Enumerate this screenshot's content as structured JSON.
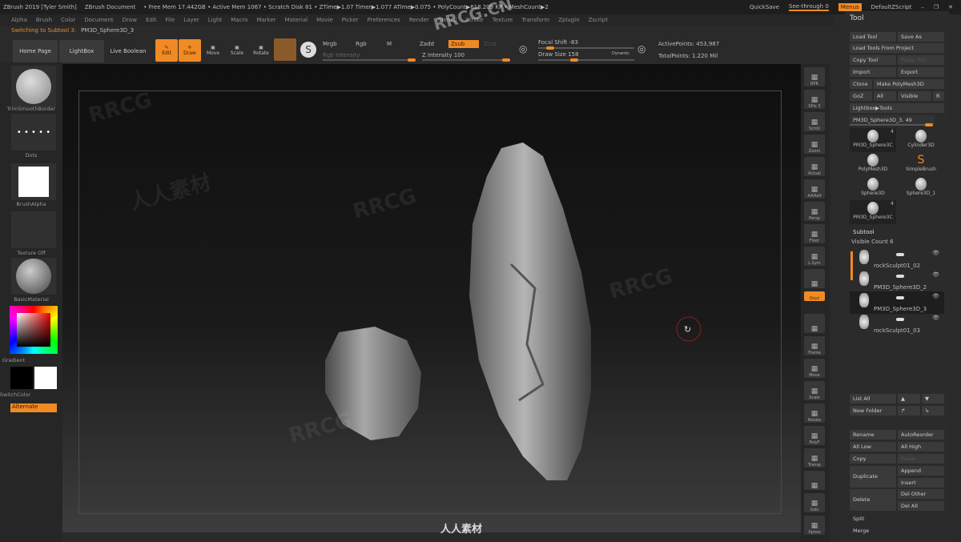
{
  "titlebar": {
    "app": "ZBrush 2019 [Tyler Smith]",
    "doc": "ZBrush Document",
    "stats": "• Free Mem 17.442GB • Active Mem 1067 • Scratch Disk 81 • ZTime▶1.07 Timer▶1.077 ATime▶0.075 • PolyCount▶618.209 KP • MeshCount▶2",
    "quicksave": "QuickSave",
    "see_through": "See-through  0",
    "menus": "Menus",
    "script": "DefaultZScript"
  },
  "menubar": [
    "Alpha",
    "Brush",
    "Color",
    "Document",
    "Draw",
    "Edit",
    "File",
    "Layer",
    "Light",
    "Macro",
    "Marker",
    "Material",
    "Movie",
    "Picker",
    "Preferences",
    "Render",
    "Stencil",
    "Stroke",
    "Texture",
    "Transform",
    "Zplugin",
    "Zscript"
  ],
  "subtitle": {
    "status": "Switching to Subtool 3:",
    "name": "PM3D_Sphere3D_3"
  },
  "toolbar": {
    "home": "Home Page",
    "lightbox": "LightBox",
    "live_boolean": "Live Boolean",
    "edit": "Edit",
    "draw": "Draw",
    "move": "Move",
    "scale": "Scale",
    "rotate": "Rotate",
    "mrgb": "Mrgb",
    "rgb": "Rgb",
    "m": "M",
    "rgb_intensity": "Rgb Intensity",
    "zadd": "Zadd",
    "zsub": "Zsub",
    "zcut": "Zcut",
    "z_intensity": "Z Intensity 100",
    "focal_shift": "Focal Shift -83",
    "draw_size": "Draw Size 158",
    "dynamic": "Dynamic",
    "active_points": "ActivePoints: 453,987",
    "total_points": "TotalPoints: 1.220 Mil",
    "z_intensity_value": 100,
    "focal_shift_value": -83,
    "draw_size_value": 158
  },
  "left_shelf": {
    "brush": "TrimSmoothBorder",
    "stroke": "Dots",
    "alpha": "BrushAlpha",
    "texture": "Texture Off",
    "material": "BasicMaterial",
    "gradient": "Gradient",
    "switch_color": "SwitchColor",
    "alternate": "Alternate"
  },
  "right_shelf": [
    "BPR",
    "SPix 3",
    "Scroll",
    "Zoom",
    "Actual",
    "AAHalf",
    "Persp",
    "Floor",
    "L.Sym",
    "",
    "Qxyz",
    "",
    "Frame",
    "Move",
    "Scale",
    "Rotate",
    "PolyF",
    "Transp",
    "",
    "Solo",
    "Xpose"
  ],
  "panel": {
    "title": "Tool",
    "load_tool": "Load Tool",
    "save_as": "Save As",
    "load_from_project": "Load Tools From Project",
    "copy_tool": "Copy Tool",
    "paste_tool": "Paste Tool",
    "import": "Import",
    "export": "Export",
    "clone": "Clone",
    "make_polymesh": "Make PolyMesh3D",
    "goz": "GoZ",
    "all": "All",
    "visible": "Visible",
    "r": "R",
    "lightbox_tools": "Lightbox▶Tools",
    "current_tool": "PM3D_Sphere3D_3. 49",
    "current_tool_value": 49,
    "tools": [
      {
        "name": "PM3D_Sphere3C",
        "badge": "4"
      },
      {
        "name": "Cylinder3D"
      },
      {
        "name": "PolyMesh3D"
      },
      {
        "name": "SimpleBrush"
      },
      {
        "name": "Sphere3D"
      },
      {
        "name": "Sphere3D_1"
      },
      {
        "name": "PM3D_Sphere3C",
        "badge": "4"
      }
    ],
    "subtool_title": "Subtool",
    "visible_count": "Visible Count 6",
    "subtools": [
      "rockSculpt01_02",
      "PM3D_Sphere3D_2",
      "PM3D_Sphere3D_3",
      "rockSculpt01_03"
    ],
    "list_all": "List All",
    "new_folder": "New Folder",
    "rename": "Rename",
    "autoreorder": "AutoReorder",
    "all_low": "All Low",
    "all_high": "All High",
    "copy": "Copy",
    "paste": "Paste",
    "duplicate": "Duplicate",
    "append": "Append",
    "insert": "Insert",
    "delete": "Delete",
    "del_other": "Del Other",
    "del_all": "Del All",
    "split": "Split",
    "merge": "Merge"
  },
  "watermarks": [
    "RRCG",
    "人人素材",
    "RRCG.CN",
    "人人素材"
  ],
  "colors": {
    "accent": "#f08a24",
    "bg": "#2a2a2a"
  }
}
